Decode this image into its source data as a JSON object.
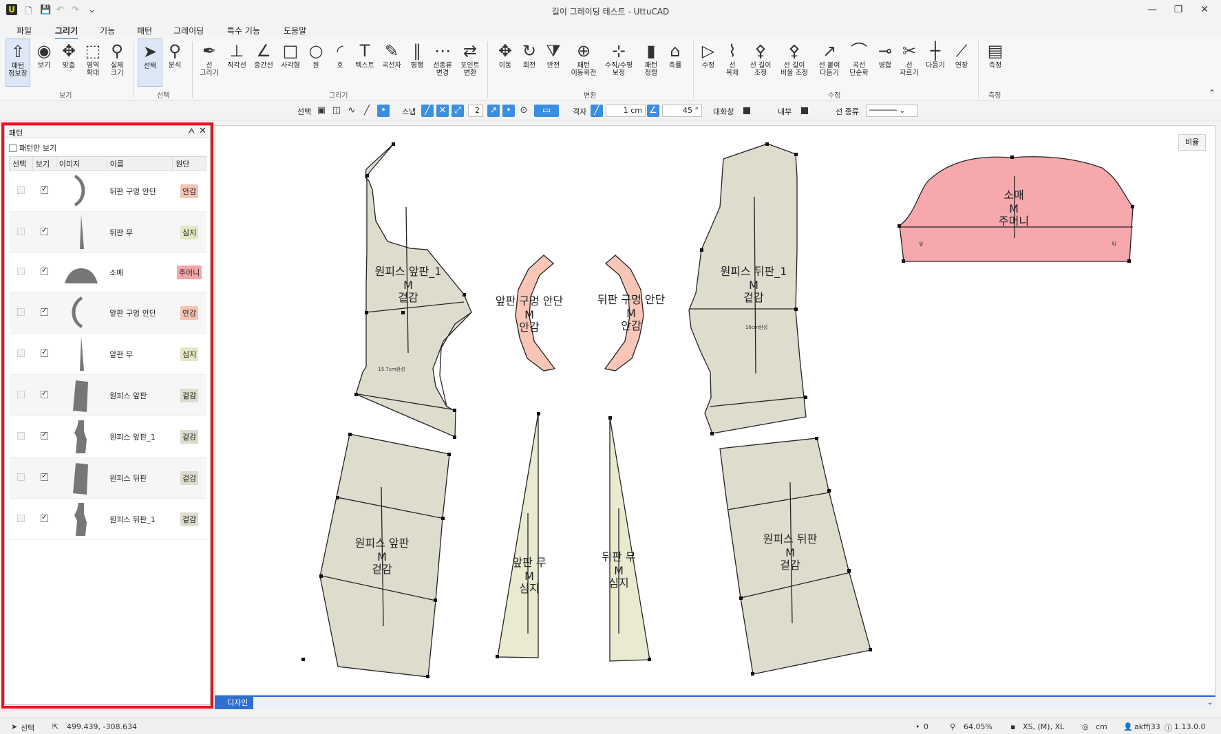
{
  "window": {
    "logo": "U",
    "title": "길이 그레이딩 테스트 - UttuCAD",
    "controls": {
      "minimize": "—",
      "restore": "❐",
      "close": "✕"
    }
  },
  "quick_access": [
    "new-file-icon",
    "save-icon",
    "undo-icon",
    "redo-icon",
    "customize-icon"
  ],
  "menu": {
    "tabs": [
      "파일",
      "그리기",
      "기능",
      "패턴",
      "그레이딩",
      "특수 기능",
      "도움말"
    ],
    "active": "그리기"
  },
  "ribbon": {
    "groups": {
      "view": "보기",
      "select": "선택",
      "draw": "그리기",
      "transform": "변환",
      "modify": "수정",
      "measure": "측정"
    },
    "buttons": [
      {
        "label": "패턴\n정보창",
        "icon": "shirt-icon",
        "glyph": "⇧"
      },
      {
        "label": "보기",
        "icon": "eye-icon",
        "glyph": "◉"
      },
      {
        "label": "맞춤",
        "icon": "fit-icon",
        "glyph": "✥"
      },
      {
        "label": "영역\n확대",
        "icon": "zoom-area-icon",
        "glyph": "⬚"
      },
      {
        "label": "실제\n크기",
        "icon": "actual-size-icon",
        "glyph": "⚲"
      },
      {
        "label": "선택",
        "icon": "cursor-icon",
        "glyph": "➤"
      },
      {
        "label": "분석",
        "icon": "analyze-icon",
        "glyph": "⚲"
      },
      {
        "label": "선\n그리기",
        "icon": "pen-icon",
        "glyph": "✒"
      },
      {
        "label": "직각선",
        "icon": "right-angle-icon",
        "glyph": "⊥"
      },
      {
        "label": "중간선",
        "icon": "mid-line-icon",
        "glyph": "∠"
      },
      {
        "label": "사각형",
        "icon": "rectangle-icon",
        "glyph": "□"
      },
      {
        "label": "원",
        "icon": "circle-icon",
        "glyph": "○"
      },
      {
        "label": "호",
        "icon": "arc-icon",
        "glyph": "◜"
      },
      {
        "label": "텍스트",
        "icon": "text-icon",
        "glyph": "T"
      },
      {
        "label": "곡선자",
        "icon": "curve-ruler-icon",
        "glyph": "✎"
      },
      {
        "label": "평행",
        "icon": "parallel-icon",
        "glyph": "∥"
      },
      {
        "label": "선종류\n변경",
        "icon": "line-type-icon",
        "glyph": "⋯"
      },
      {
        "label": "포인트\n변환",
        "icon": "point-convert-icon",
        "glyph": "⇄"
      },
      {
        "label": "이동",
        "icon": "move-icon",
        "glyph": "✥"
      },
      {
        "label": "회전",
        "icon": "rotate-icon",
        "glyph": "↻"
      },
      {
        "label": "반전",
        "icon": "mirror-icon",
        "glyph": "⧩"
      },
      {
        "label": "패턴\n이동회전",
        "icon": "pattern-move-rotate-icon",
        "glyph": "⊕"
      },
      {
        "label": "수직/수평\n보정",
        "icon": "align-icon",
        "glyph": "⊹"
      },
      {
        "label": "패턴\n정렬",
        "icon": "pattern-sort-icon",
        "glyph": "▮"
      },
      {
        "label": "축률",
        "icon": "shrink-icon",
        "glyph": "⌂"
      },
      {
        "label": "수정",
        "icon": "edit-icon",
        "glyph": "▷"
      },
      {
        "label": "선\n복제",
        "icon": "line-copy-icon",
        "glyph": "⌇"
      },
      {
        "label": "선 길이\n조정",
        "icon": "line-length-icon",
        "glyph": "⚴"
      },
      {
        "label": "선 길이\n비율 조정",
        "icon": "line-ratio-icon",
        "glyph": "⚴"
      },
      {
        "label": "선 붙여\n다듬기",
        "icon": "line-join-icon",
        "glyph": "↗"
      },
      {
        "label": "곡선\n단순화",
        "icon": "curve-simplify-icon",
        "glyph": "⌒"
      },
      {
        "label": "병합",
        "icon": "merge-icon",
        "glyph": "⊸"
      },
      {
        "label": "선\n자르기",
        "icon": "scissors-icon",
        "glyph": "✂"
      },
      {
        "label": "다듬기",
        "icon": "trim-icon",
        "glyph": "┼"
      },
      {
        "label": "연장",
        "icon": "extend-icon",
        "glyph": "⟋"
      },
      {
        "label": "측정",
        "icon": "tape-measure-icon",
        "glyph": "▤"
      }
    ]
  },
  "toolbar": {
    "select_label": "선택",
    "snap_label": "스냅",
    "snap_value": "2",
    "grid_label": "격자",
    "grid_value": "1 cm",
    "angle_value": "45 °",
    "dialog_label": "대화창",
    "inner_label": "내부",
    "line_type_label": "선 종류"
  },
  "panel": {
    "title": "패턴",
    "pin": "ᗅ",
    "close": "✕",
    "only_patterns": "패턴만 보기",
    "columns": [
      "선택",
      "보기",
      "이미지",
      "이름",
      "원단"
    ],
    "rows": [
      {
        "name": "뒤판 구멍 안단",
        "fabric": "안감",
        "shape": "arc-right"
      },
      {
        "name": "뒤판 무",
        "fabric": "심지",
        "shape": "spike"
      },
      {
        "name": "소매",
        "fabric": "주머니",
        "shape": "dome"
      },
      {
        "name": "앞판 구멍 안단",
        "fabric": "안감",
        "shape": "arc-left"
      },
      {
        "name": "앞판 무",
        "fabric": "심지",
        "shape": "spike"
      },
      {
        "name": "원피스 앞판",
        "fabric": "겉감",
        "shape": "panel"
      },
      {
        "name": "원피스 앞판_1",
        "fabric": "겉감",
        "shape": "bodice"
      },
      {
        "name": "원피스 뒤판",
        "fabric": "겉감",
        "shape": "panel"
      },
      {
        "name": "원피스 뒤판_1",
        "fabric": "겉감",
        "shape": "bodice"
      }
    ],
    "fabric_colors": {
      "안감": "#f7c3b4",
      "심지": "#e5e7c4",
      "주머니": "#f4a5aa",
      "겉감": "#dddccd"
    }
  },
  "canvas": {
    "ratio_button": "비율",
    "pieces": [
      {
        "id": "front-bodice",
        "lines": [
          "원피스 앞판_1",
          "M",
          "겉감"
        ],
        "measure": "15.7cm완성"
      },
      {
        "id": "front-facing",
        "lines": [
          "앞판 구멍 안단",
          "M",
          "안감"
        ]
      },
      {
        "id": "back-facing",
        "lines": [
          "뒤판 구멍 안단",
          "M",
          "안감"
        ]
      },
      {
        "id": "back-bodice",
        "lines": [
          "원피스 뒤판_1",
          "M",
          "겉감"
        ],
        "measure": "16cm완성"
      },
      {
        "id": "sleeve",
        "lines": [
          "소매",
          "M",
          "주머니"
        ],
        "left_mark": "앞",
        "right_mark": "뒤"
      },
      {
        "id": "front-skirt",
        "lines": [
          "원피스 앞판",
          "M",
          "겉감"
        ]
      },
      {
        "id": "front-gusset",
        "lines": [
          "앞판 무",
          "M",
          "심지"
        ]
      },
      {
        "id": "back-gusset",
        "lines": [
          "뒤판 무",
          "M",
          "심지"
        ]
      },
      {
        "id": "back-skirt",
        "lines": [
          "원피스 뒤판",
          "M",
          "겉감"
        ]
      }
    ],
    "colors": {
      "body": "#dddccd",
      "facing": "#f8c5b6",
      "gusset": "#e9ead0",
      "sleeve": "#f6a8ac"
    }
  },
  "bottom_tab": "디자인",
  "status": {
    "mode": "선택",
    "coords": "499.439, -308.634",
    "count": "0",
    "zoom": "64.05%",
    "sizes": "XS, (M), XL",
    "unit": "cm",
    "user": "akffj33",
    "version": "1.13.0.0"
  }
}
